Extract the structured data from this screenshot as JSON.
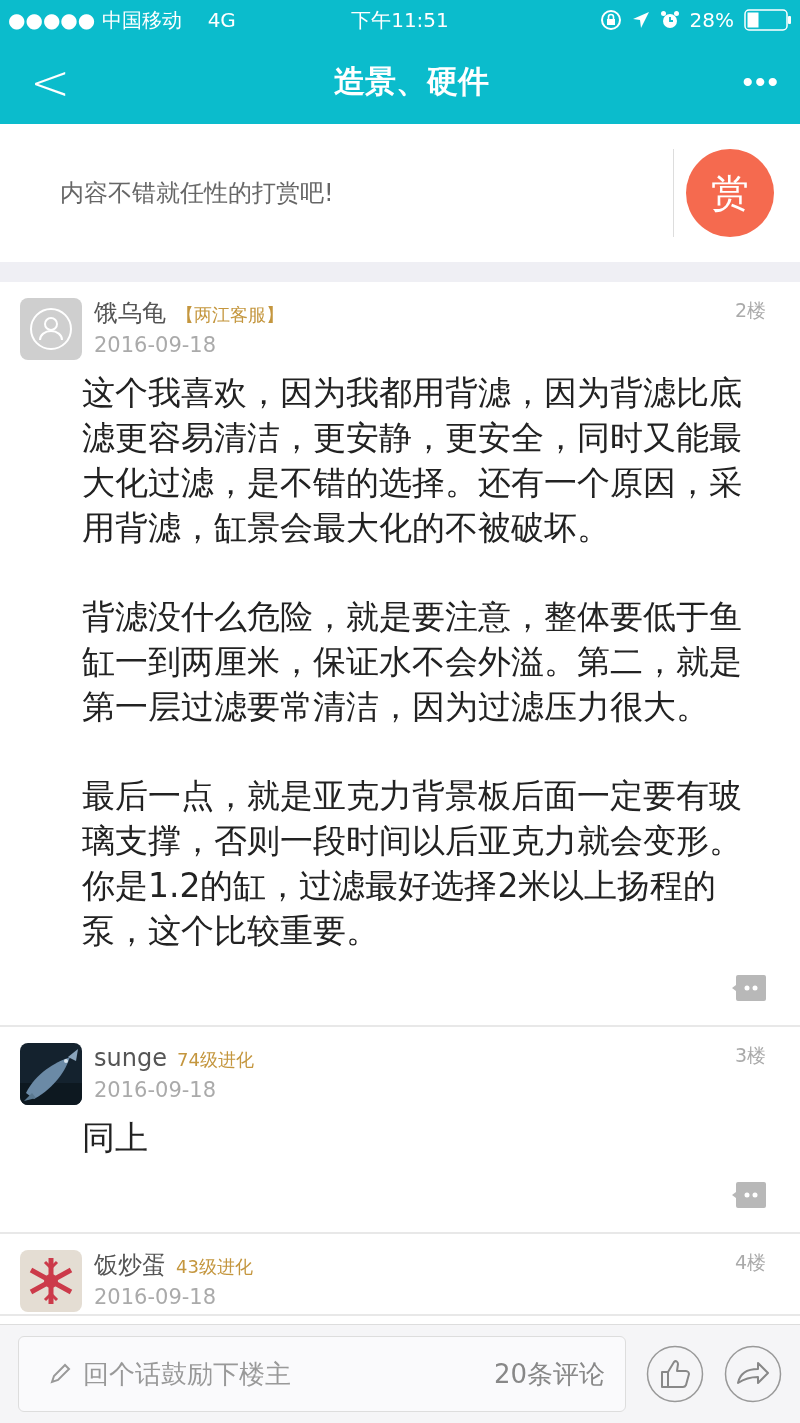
{
  "status_bar": {
    "carrier": "●●●●● 中国移动",
    "network": "4G",
    "time": "下午11:51",
    "battery": "28%"
  },
  "nav": {
    "back": "<",
    "title": "造景、硬件",
    "more": "•••"
  },
  "reward": {
    "prompt": "内容不错就任性的打赏吧!",
    "button": "赏"
  },
  "posts": [
    {
      "avatar": {
        "kind": "default"
      },
      "name": "饿乌龟",
      "tag": "【两江客服】",
      "date": "2016-09-18",
      "floor": "2楼",
      "paragraphs": [
        "这个我喜欢，因为我都用背滤，因为背滤比底滤更容易清洁，更安静，更安全，同时又能最大化过滤，是不错的选择。还有一个原因，采用背滤，缸景会最大化的不被破坏。",
        "背滤没什么危险，就是要注意，整体要低于鱼缸一到两厘米，保证水不会外溢。第二，就是第一层过滤要常清洁，因为过滤压力很大。",
        "最后一点，就是亚克力背景板后面一定要有玻璃支撑，否则一段时间以后亚克力就会变形。你是1.2的缸，过滤最好选择2米以上扬程的泵，这个比较重要。"
      ]
    },
    {
      "name": "sunge",
      "tag": "74级进化",
      "date": "2016-09-18",
      "floor": "3楼",
      "paragraphs": [
        "同上"
      ]
    },
    {
      "name": "饭炒蛋",
      "tag": "43级进化",
      "date": "2016-09-18",
      "floor": "4楼"
    }
  ],
  "bottom_bar": {
    "placeholder": "回个话鼓励下楼主",
    "comment_count": "20条评论"
  }
}
